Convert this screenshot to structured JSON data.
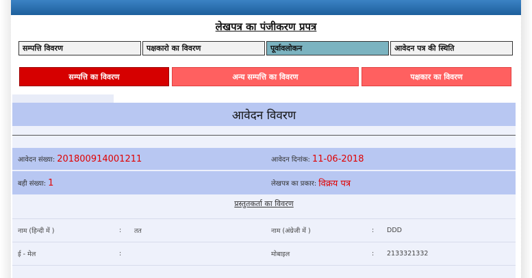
{
  "title": "लेखपत्र का पंजीकरण प्रपत्र",
  "steps": [
    {
      "label": "सम्पत्ति विवरण"
    },
    {
      "label": "पक्षकारो का विवरण"
    },
    {
      "label": "पूर्वावलोकन"
    },
    {
      "label": "आवेदन पत्र की स्थिति"
    }
  ],
  "tabs": [
    {
      "label": "सम्पत्ति का विवरण"
    },
    {
      "label": "अन्य सम्पत्ति का विवरण"
    },
    {
      "label": "पक्षकार का विवरण"
    }
  ],
  "panel": {
    "heading": "आवेदन विवरण",
    "application_no_label": "आवेदन संख्या:",
    "application_no": "201800914001211",
    "application_date_label": "आवेदन दिनांक:",
    "application_date": "11-06-2018",
    "bahi_label": "बही संख्या:",
    "bahi_value": "1",
    "deed_type_label": "लेखपत्र का प्रकार:",
    "deed_type_value": "विक्रय पत्र",
    "presenter_heading": "प्रस्तुतकर्ता का विवरण",
    "name_hindi_label": "नाम (हिन्दी में )",
    "name_hindi_value": "तत",
    "name_english_label": "नाम (अंग्रेजी में )",
    "name_english_value": "DDD",
    "email_label": "ई - मेल",
    "email_value": "",
    "mobile_label": "मोबाइल",
    "mobile_value": "2133321332",
    "colon": ":"
  },
  "colors": {
    "header_bar": "#1d5f9c",
    "active_step": "#7bb3c0",
    "active_tab": "#d60000",
    "tab": "#ff6060",
    "panel_band": "#b8c7f2",
    "value_red": "#e00000"
  }
}
